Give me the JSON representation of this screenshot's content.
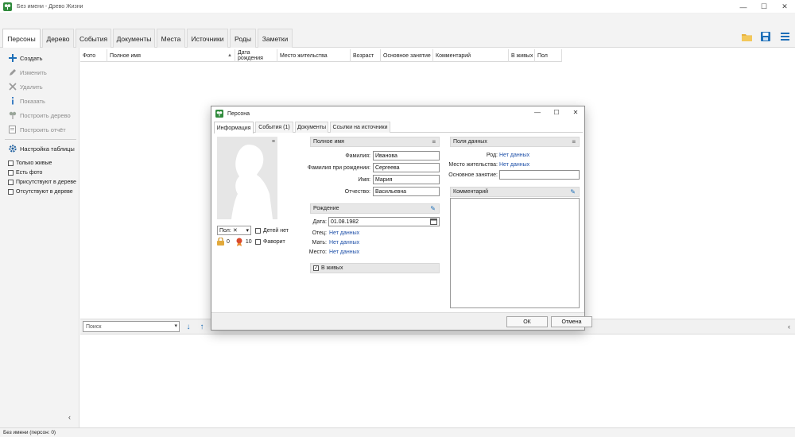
{
  "window": {
    "title": "Без имени - Древо Жизни",
    "controls": [
      "—",
      "☐",
      "✕"
    ]
  },
  "tabs": [
    {
      "label": "Персоны",
      "active": true
    },
    {
      "label": "Дерево"
    },
    {
      "label": "События"
    },
    {
      "label": "Документы"
    },
    {
      "label": "Места"
    },
    {
      "label": "Источники"
    },
    {
      "label": "Роды"
    },
    {
      "label": "Заметки"
    }
  ],
  "toolbar": {
    "icons": [
      "open-folder-icon",
      "save-icon",
      "menu-icon"
    ]
  },
  "sidebar": {
    "actions": [
      {
        "label": "Создать",
        "icon": "plus-icon",
        "enabled": true
      },
      {
        "label": "Изменить",
        "icon": "pencil-icon",
        "enabled": false
      },
      {
        "label": "Удалить",
        "icon": "delete-icon",
        "enabled": false
      },
      {
        "label": "Показать",
        "icon": "info-icon",
        "enabled": false
      },
      {
        "label": "Построить дерево",
        "icon": "tree-icon",
        "enabled": false
      },
      {
        "label": "Построить отчёт",
        "icon": "report-icon",
        "enabled": false
      }
    ],
    "table_settings": "Настройка таблицы",
    "filters": [
      {
        "label": "Только живые",
        "checked": false
      },
      {
        "label": "Есть фото",
        "checked": false
      },
      {
        "label": "Присутствуют в дереве",
        "checked": false
      },
      {
        "label": "Отсутствуют в дереве",
        "checked": false
      }
    ],
    "collapse": "‹"
  },
  "grid": {
    "columns": [
      "Фото",
      "Полное имя",
      "Дата рождения",
      "Место жительства",
      "Возраст",
      "Основное занятие",
      "Комментарий",
      "В живых",
      "Пол"
    ],
    "sort_indicator": "▲"
  },
  "search": {
    "placeholder": "Поиск",
    "down": "↓",
    "up": "↑",
    "chevron": "‹"
  },
  "status": "Без имени (персон: 0)",
  "dialog": {
    "title": "Персона",
    "controls": [
      "—",
      "☐",
      "✕"
    ],
    "tabs": [
      {
        "label": "Информация",
        "active": true
      },
      {
        "label": "События (1)"
      },
      {
        "label": "Документы"
      },
      {
        "label": "Ссылки на источники"
      }
    ],
    "photo_menu": "≡",
    "sex": {
      "label": "Пол:",
      "value": "✕"
    },
    "no_children": "Детей нет",
    "favorite": "Фаворит",
    "badges": [
      {
        "icon": "lock-icon",
        "value": "0"
      },
      {
        "icon": "award-icon",
        "value": "10"
      }
    ],
    "full_name": {
      "header": "Полное имя",
      "fields": [
        {
          "label": "Фамилия:",
          "value": "Иванова"
        },
        {
          "label": "Фамилия при рождении:",
          "value": "Сергеева"
        },
        {
          "label": "Имя:",
          "value": "Мария"
        },
        {
          "label": "Отчество:",
          "value": "Васильевна"
        }
      ]
    },
    "birth": {
      "header": "Рождение",
      "date_label": "Дата:",
      "date_value": "01.08.1982",
      "father_label": "Отец:",
      "father_value": "Нет данных",
      "mother_label": "Мать:",
      "mother_value": "Нет данных",
      "place_label": "Место:",
      "place_value": "Нет данных"
    },
    "alive": {
      "label": "В живых",
      "checked": true
    },
    "data_fields": {
      "header": "Поля данных",
      "rod_label": "Род:",
      "rod_value": "Нет данных",
      "residence_label": "Место жительства:",
      "residence_value": "Нет данных",
      "occupation_label": "Основное занятие:",
      "occupation_value": ""
    },
    "comment": {
      "header": "Комментарий"
    },
    "ok": "ОК",
    "cancel": "Отмена"
  },
  "colors": {
    "accent": "#1e6fb8",
    "link": "#1d4fa8",
    "section": "#e7e7e7"
  }
}
